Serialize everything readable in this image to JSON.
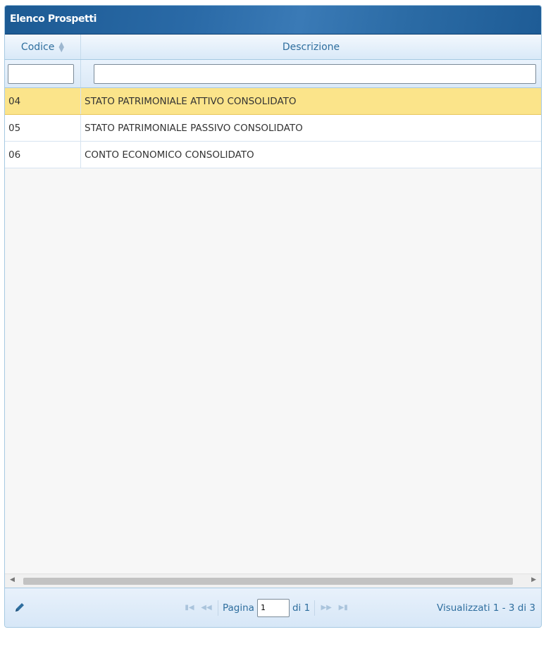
{
  "panel": {
    "title": "Elenco Prospetti"
  },
  "columns": {
    "codice": "Codice",
    "descrizione": "Descrizione"
  },
  "filters": {
    "codice_value": "",
    "descrizione_value": ""
  },
  "rows": [
    {
      "codice": "04",
      "descrizione": "STATO PATRIMONIALE ATTIVO CONSOLIDATO",
      "selected": true
    },
    {
      "codice": "05",
      "descrizione": "STATO PATRIMONIALE PASSIVO CONSOLIDATO",
      "selected": false
    },
    {
      "codice": "06",
      "descrizione": "CONTO ECONOMICO CONSOLIDATO",
      "selected": false
    }
  ],
  "pager": {
    "page_label": "Pagina",
    "page_value": "1",
    "of_label": "di 1",
    "records_info": "Visualizzati 1 - 3 di 3"
  },
  "icons": {
    "edit": "pencil-icon",
    "first": "first-page-icon",
    "prev": "prev-page-icon",
    "next": "next-page-icon",
    "last": "last-page-icon"
  },
  "colors": {
    "title_bar": "#2a6aa7",
    "selected_row": "#fbe48a",
    "header_text": "#2e6e9e"
  }
}
